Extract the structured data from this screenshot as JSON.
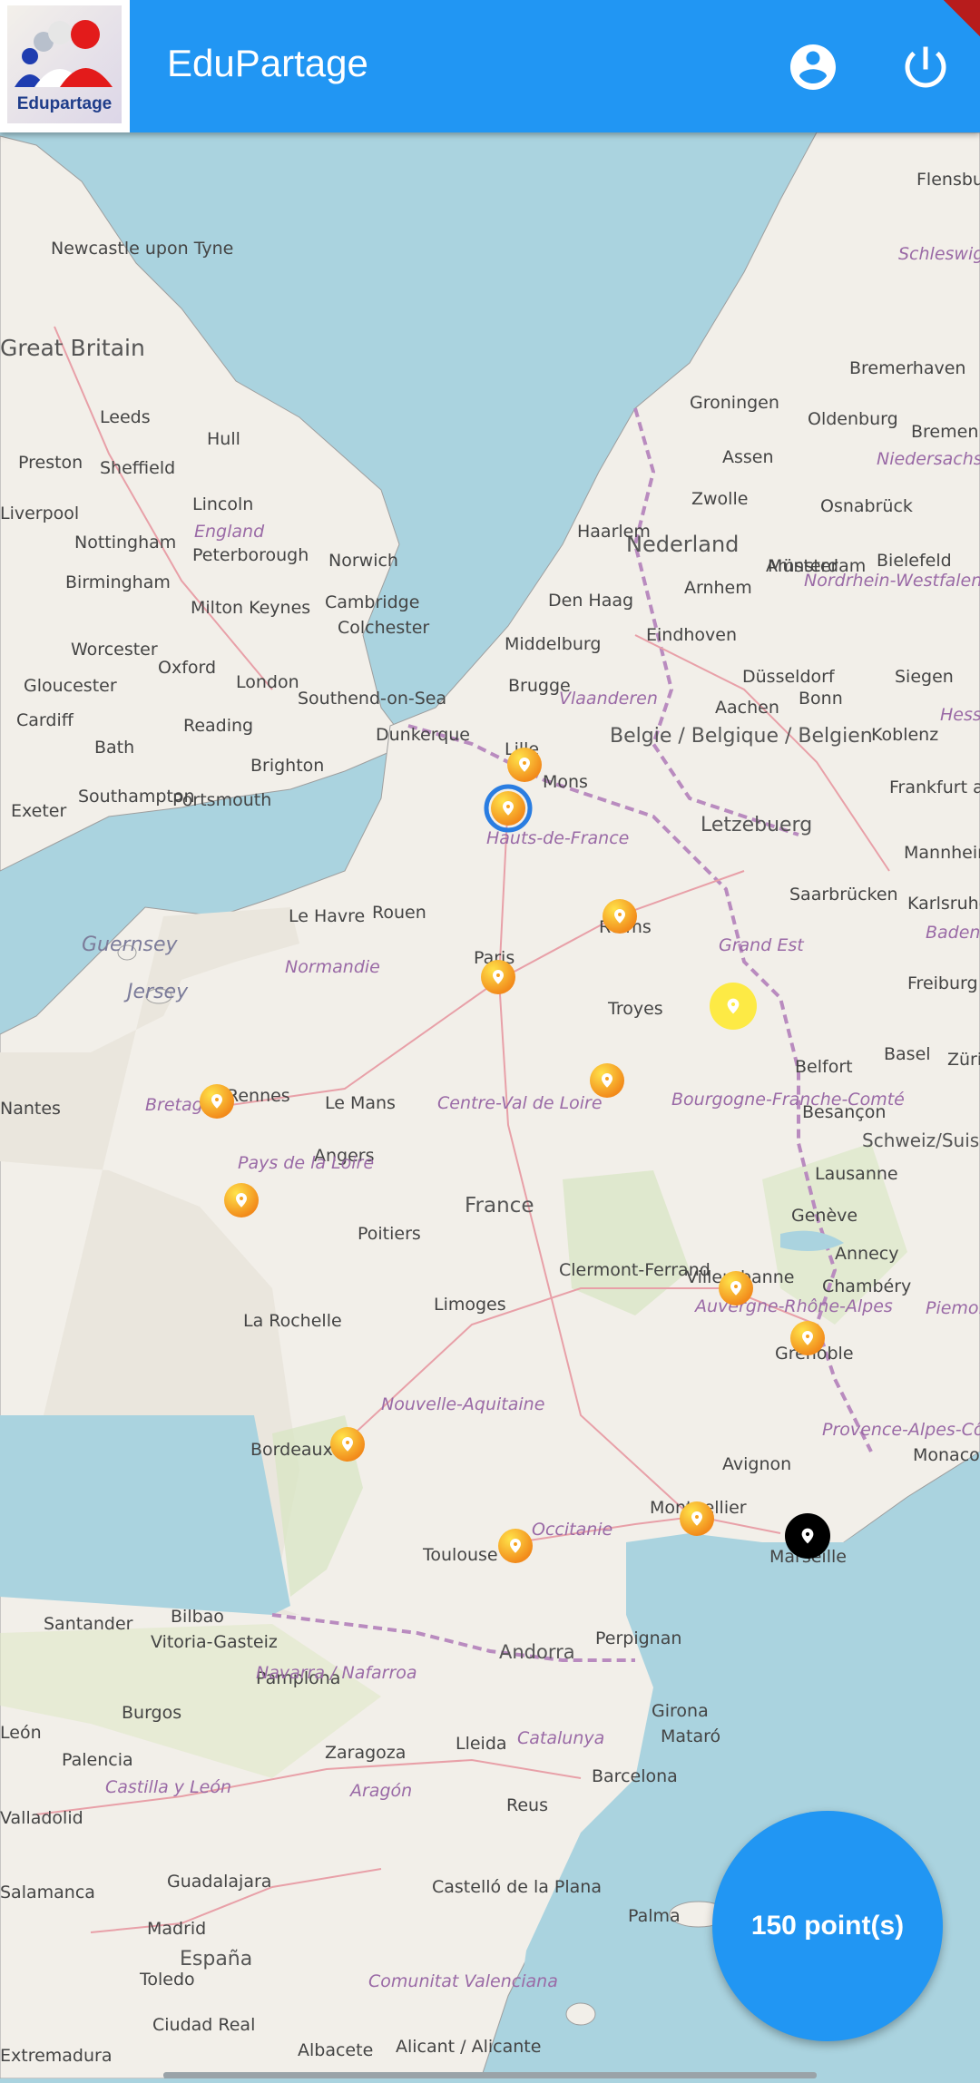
{
  "app": {
    "title": "EduPartage",
    "logo_text": "Edupartage",
    "profile_icon": "account-circle-icon",
    "logout_icon": "power-icon"
  },
  "fab": {
    "label": "150 point(s)"
  },
  "colors": {
    "appbar": "#2196f3",
    "sea": "#aad3df",
    "land": "#f2efe9",
    "marker_orange": "#f7a51c",
    "marker_yellow": "#fdea45",
    "marker_selected_ring": "#2a7de1",
    "marker_black": "#000000"
  },
  "map": {
    "countries": [
      "Great Britain",
      "Nederland",
      "Belgie / Belgique / Belgien",
      "Letzebuerg",
      "France",
      "Andorra",
      "España",
      "Schweiz/Suisse/Svizzera"
    ],
    "cities": [
      "Newcastle upon Tyne",
      "Leeds",
      "Hull",
      "Preston",
      "Sheffield",
      "Liverpool",
      "Lincoln",
      "Nottingham",
      "Birmingham",
      "Peterborough",
      "Norwich",
      "Cambridge",
      "Milton Keynes",
      "Colchester",
      "Worcester",
      "Oxford",
      "London",
      "Southend-on-Sea",
      "Gloucester",
      "Cardiff",
      "Reading",
      "Bath",
      "Brighton",
      "Southampton",
      "Portsmouth",
      "Exeter",
      "Flensburg",
      "Bremerhaven",
      "Groningen",
      "Oldenburg",
      "Bremen",
      "Assen",
      "Zwolle",
      "Osnabrück",
      "Haarlem",
      "Amsterdam",
      "Den Haag",
      "Arnhem",
      "Münster",
      "Bielefeld",
      "Middelburg",
      "Eindhoven",
      "Düsseldorf",
      "Siegen",
      "Brugge",
      "Aachen",
      "Bonn",
      "Koblenz",
      "Dunkerque",
      "Lille",
      "Mons",
      "Frankfurt am Main",
      "Mannheim",
      "Saarbrücken",
      "Karlsruhe",
      "Reims",
      "Freiburg im Breisgau",
      "Basel",
      "Zürich",
      "Belfort",
      "Besançon",
      "Lausanne",
      "Genève",
      "Annecy",
      "Chambéry",
      "Grenoble",
      "Le Havre",
      "Rouen",
      "Paris",
      "Troyes",
      "Rennes",
      "Le Mans",
      "Angers",
      "Nantes",
      "Poitiers",
      "Clermont-Ferrand",
      "Villeurbanne",
      "Limoges",
      "La Rochelle",
      "Bordeaux",
      "Avignon",
      "Monaco",
      "Montpellier",
      "Marseille",
      "Toulouse",
      "Perpignan",
      "Santander",
      "Bilbao",
      "Vitoria-Gasteiz",
      "Pamplona",
      "Burgos",
      "León",
      "Palencia",
      "Valladolid",
      "Zaragoza",
      "Lleida",
      "Girona",
      "Mataró",
      "Barcelona",
      "Reus",
      "Salamanca",
      "Guadalajara",
      "Madrid",
      "Toledo",
      "Castelló de la Plana",
      "Palma",
      "Ciudad Real",
      "Albacete",
      "Alicant / Alicante",
      "Extremadura"
    ],
    "regions": [
      "England",
      "Schleswig-Holstein",
      "Niedersachsen",
      "Nordrhein-Westfalen",
      "Vlaanderen",
      "Hessen",
      "Hauts-de-France",
      "Normandie",
      "Grand Est",
      "Baden-Württemberg",
      "Bretagne",
      "Pays de la Loire",
      "Centre-Val de Loire",
      "Bourgogne-Franche-Comté",
      "Auvergne-Rhône-Alpes",
      "Nouvelle-Aquitaine",
      "Occitanie",
      "Provence-Alpes-Côte d'Azur",
      "Navarra / Nafarroa",
      "Catalunya",
      "Aragón",
      "Castilla y León",
      "Comunitat Valenciana",
      "Piemonte",
      "Guernsey",
      "Jersey"
    ],
    "markers": [
      {
        "label": "Lille area",
        "type": "orange"
      },
      {
        "label": "Hauts-de-France",
        "type": "orange-selected"
      },
      {
        "label": "Reims",
        "type": "orange"
      },
      {
        "label": "Paris",
        "type": "orange"
      },
      {
        "label": "Grand Est",
        "type": "yellow"
      },
      {
        "label": "Rennes",
        "type": "orange"
      },
      {
        "label": "Troyes area",
        "type": "orange"
      },
      {
        "label": "Nantes",
        "type": "orange"
      },
      {
        "label": "Villeurbanne",
        "type": "orange"
      },
      {
        "label": "Grenoble",
        "type": "orange"
      },
      {
        "label": "Bordeaux",
        "type": "orange"
      },
      {
        "label": "Toulouse",
        "type": "orange"
      },
      {
        "label": "Montpellier",
        "type": "orange"
      },
      {
        "label": "Marseille",
        "type": "black"
      }
    ]
  }
}
